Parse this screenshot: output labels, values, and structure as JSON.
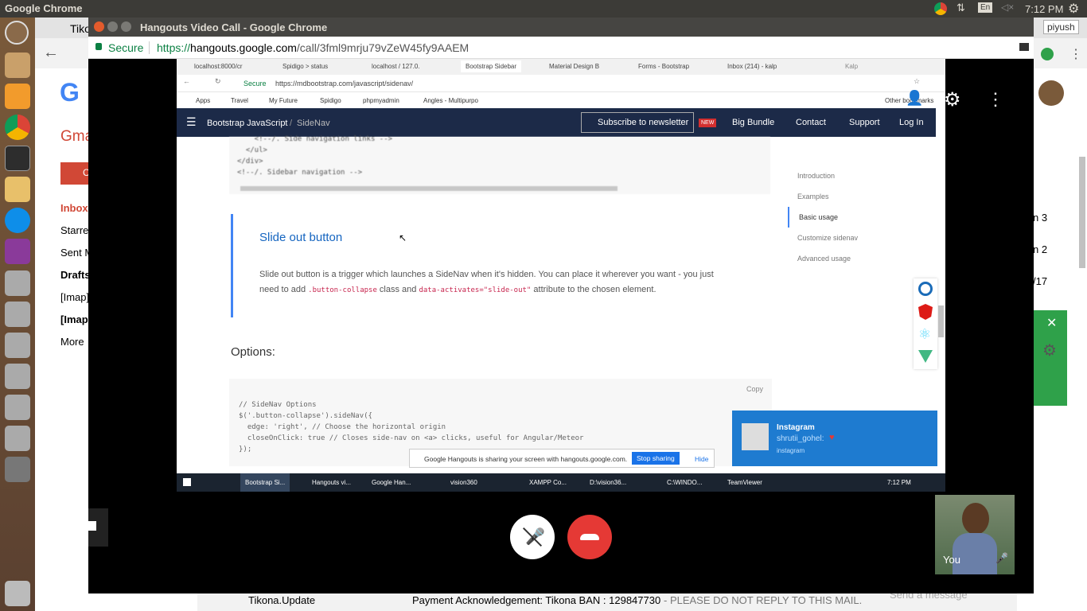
{
  "topbar": {
    "app": "Google Chrome",
    "lang": "En",
    "time": "7:12 PM"
  },
  "gmail": {
    "tab": "Tiko",
    "logo": "G",
    "label": "Gma",
    "compose": "C",
    "nav": [
      "Inbox",
      "Starre",
      "Sent M",
      "Drafts",
      "[Imap]",
      "[Imap",
      "More"
    ],
    "right": [
      "n 3",
      "n 2",
      "/17"
    ],
    "mail": {
      "sender": "Tikona.Update",
      "subject": "Payment Acknowledgement: Tikona BAN : 129847730",
      "snippet": " - PLEASE DO NOT REPLY TO THIS MAIL.",
      "send": "Send a message"
    }
  },
  "hangouts": {
    "title": "Hangouts Video Call - Google Chrome",
    "secure": "Secure",
    "url_pre": "https://",
    "url_host": "hangouts.google.com",
    "url_path": "/call/3fml9mrju79vZeW45fy9AAEM",
    "profile": "piyush",
    "you": "You"
  },
  "shared": {
    "tabs": [
      "localhost:8000/cr",
      "Spidigo > status",
      "localhost / 127.0.",
      "Bootstrap Sidebar",
      "Material Design B",
      "Forms - Bootstrap",
      "Inbox (214) - kalp",
      "",
      "Kalp"
    ],
    "url": "https://mdbootstrap.com/javascript/sidenav/",
    "secure": "Secure",
    "bookmarks": [
      "Apps",
      "Travel",
      "My Future",
      "Spidigo",
      "phpmyadmin",
      "Angles - Multipurpo",
      "",
      "Other bookmarks"
    ],
    "nav": {
      "crumb1": "Bootstrap JavaScript",
      "crumb2": "SideNav",
      "subscribe": "Subscribe to newsletter",
      "new": "NEW",
      "bundle": "Big Bundle",
      "contact": "Contact",
      "support": "Support",
      "login": "Log In"
    },
    "code_top": [
      "    <!--/. Side navigation links -->",
      "  </ul>",
      "</div>",
      "<!--/. Sidebar navigation -->"
    ],
    "heading": "Slide out button",
    "para1": "Slide out button is a trigger which launches a SideNav when it's hidden. You can place it wherever you want - you just",
    "para2a": "need to add ",
    "code1": ".button-collapse",
    "para2b": " class and ",
    "code2": "data-activates=\"slide-out\"",
    "para2c": " attribute to the chosen element.",
    "options": "Options:",
    "copy": "Copy",
    "code_bottom": [
      "// SideNav Options",
      "$('.button-collapse').sideNav({",
      "  edge: 'right', // Choose the horizontal origin",
      "  closeOnClick: true // Closes side-nav on <a> clicks, useful for Angular/Meteor",
      "});"
    ],
    "toc": [
      "Introduction",
      "Examples",
      "Basic usage",
      "Customize sidenav",
      "Advanced usage"
    ],
    "notify": {
      "app": "Instagram",
      "user": "shrutii_gohel:",
      "source": "instagram"
    },
    "sharebar": {
      "text": "Google Hangouts is sharing your screen with hangouts.google.com.",
      "stop": "Stop sharing",
      "hide": "Hide"
    },
    "taskbar": [
      "Bootstrap Si...",
      "Hangouts vi...",
      "Google Han...",
      "",
      "vision360",
      "",
      "XAMPP Co...",
      "D:\\vision36...",
      "",
      "C:\\WINDO...",
      "TeamViewer"
    ],
    "time": "7:12 PM"
  }
}
